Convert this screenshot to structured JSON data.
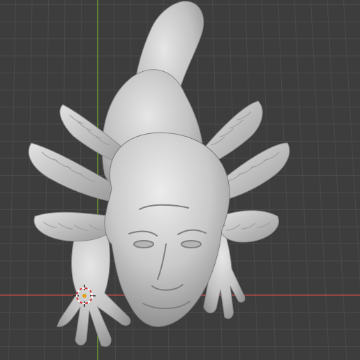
{
  "viewport": {
    "background_color": "#3d3d3d",
    "grid": true,
    "grid_color": "#4a4a4a",
    "x_axis_color": "#b04a4a",
    "y_axis_color": "#6b9a2e"
  },
  "model": {
    "name": "sculpted-axolotl-with-human-head",
    "material_color": "#c8c8c8",
    "shading": "solid-matcap-grey"
  },
  "cursor_3d": {
    "icon": "3d-cursor-icon",
    "ring_colors": [
      "#ffffff",
      "#d03030"
    ]
  }
}
